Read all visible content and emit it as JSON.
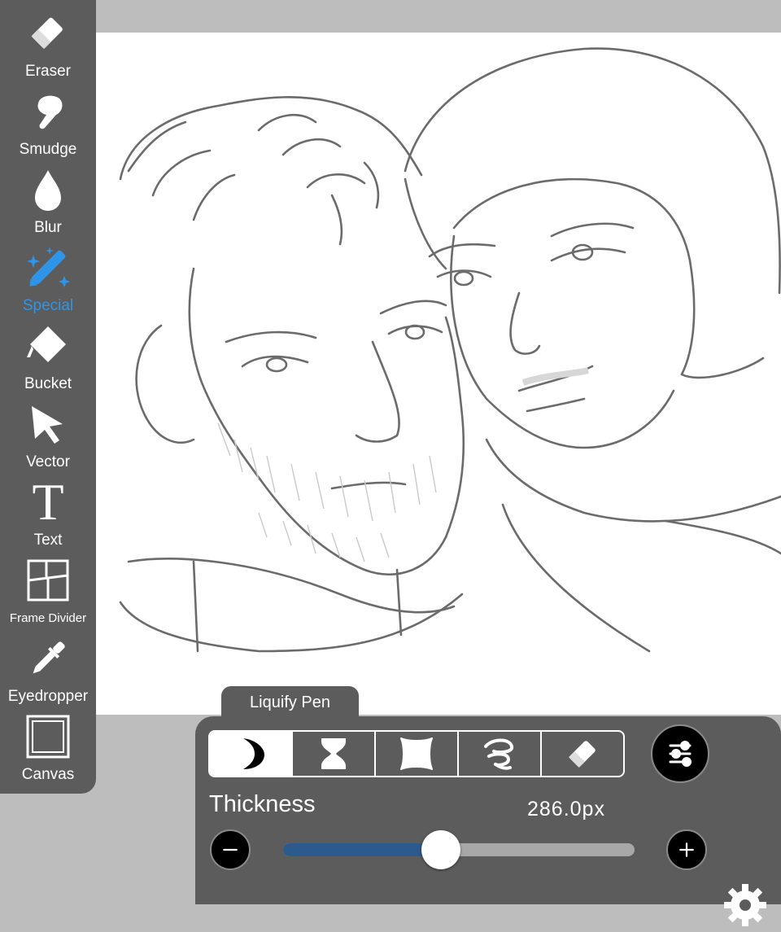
{
  "toolbar": {
    "tools": [
      {
        "label": "Eraser",
        "icon": "eraser-icon"
      },
      {
        "label": "Smudge",
        "icon": "smudge-icon"
      },
      {
        "label": "Blur",
        "icon": "blur-drop-icon"
      },
      {
        "label": "Special",
        "icon": "magic-wand-icon",
        "active": true
      },
      {
        "label": "Bucket",
        "icon": "bucket-icon"
      },
      {
        "label": "Vector",
        "icon": "arrow-cursor-icon"
      },
      {
        "label": "Text",
        "icon": "text-t-icon"
      },
      {
        "label": "Frame Divider",
        "icon": "frame-divider-icon"
      },
      {
        "label": "Eyedropper",
        "icon": "eyedropper-icon"
      },
      {
        "label": "Canvas",
        "icon": "canvas-square-icon"
      }
    ]
  },
  "panel": {
    "tab_label": "Liquify Pen",
    "modes": [
      {
        "icon": "crescent-moon-icon",
        "selected": true
      },
      {
        "icon": "hourglass-icon"
      },
      {
        "icon": "pinch-shape-icon"
      },
      {
        "icon": "twirl-icon"
      },
      {
        "icon": "eraser-icon"
      }
    ],
    "settings_icon": "sliders-icon",
    "thickness_label": "Thickness",
    "thickness_value": "286.0px",
    "slider_fraction": 0.45
  },
  "colors": {
    "accent": "#2f95e8",
    "toolbar_bg": "#5c5c5c",
    "slider_fill": "#2d5a8c"
  }
}
